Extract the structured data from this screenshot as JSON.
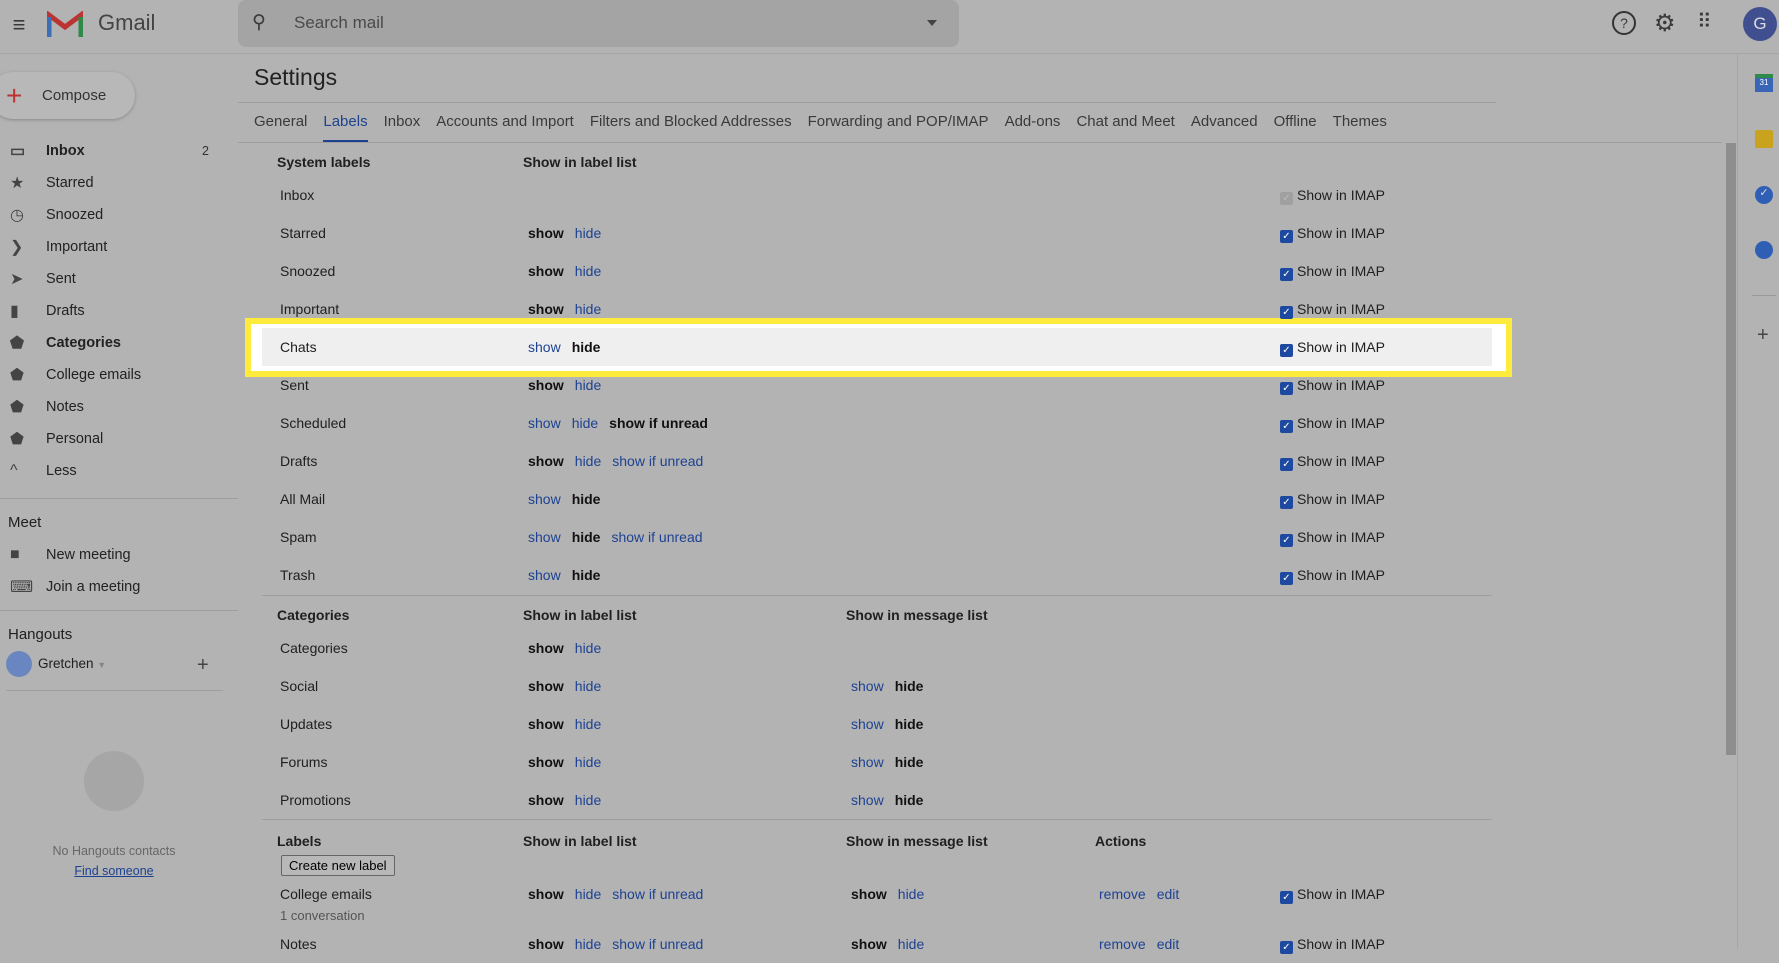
{
  "app": {
    "name": "Gmail",
    "avatar_letter": "G"
  },
  "search": {
    "placeholder": "Search mail"
  },
  "compose": "Compose",
  "sidebar": {
    "items": [
      {
        "label": "Inbox",
        "icon": "inbox-icon",
        "glyph": "▭",
        "bold": true,
        "count": "2"
      },
      {
        "label": "Starred",
        "icon": "star-icon",
        "glyph": "★"
      },
      {
        "label": "Snoozed",
        "icon": "clock-icon",
        "glyph": "◷"
      },
      {
        "label": "Important",
        "icon": "important-icon",
        "glyph": "❯"
      },
      {
        "label": "Sent",
        "icon": "send-icon",
        "glyph": "➤"
      },
      {
        "label": "Drafts",
        "icon": "draft-icon",
        "glyph": "▮"
      },
      {
        "label": "Categories",
        "icon": "label-icon",
        "glyph": "⬟",
        "bold": true
      },
      {
        "label": "College emails",
        "icon": "label-icon",
        "glyph": "⬟"
      },
      {
        "label": "Notes",
        "icon": "label-icon",
        "glyph": "⬟"
      },
      {
        "label": "Personal",
        "icon": "label-icon",
        "glyph": "⬟"
      },
      {
        "label": "Less",
        "icon": "chevron-up-icon",
        "glyph": "^"
      }
    ]
  },
  "meet": {
    "title": "Meet",
    "new_meeting": "New meeting",
    "join": "Join a meeting"
  },
  "hangouts": {
    "title": "Hangouts",
    "user": "Gretchen",
    "empty": "No Hangouts contacts",
    "find": "Find someone"
  },
  "settings": {
    "title": "Settings",
    "tabs": [
      "General",
      "Labels",
      "Inbox",
      "Accounts and Import",
      "Filters and Blocked Addresses",
      "Forwarding and POP/IMAP",
      "Add-ons",
      "Chat and Meet",
      "Advanced",
      "Offline",
      "Themes"
    ],
    "active_tab": "Labels"
  },
  "system": {
    "header": "System labels",
    "col_label_list": "Show in label list",
    "imap_label": "Show in IMAP",
    "rows": [
      {
        "name": "Inbox",
        "opts": [],
        "imap": "disabled"
      },
      {
        "name": "Starred",
        "opts": [
          [
            "show",
            1
          ],
          [
            "hide",
            0
          ]
        ],
        "imap": "checked"
      },
      {
        "name": "Snoozed",
        "opts": [
          [
            "show",
            1
          ],
          [
            "hide",
            0
          ]
        ],
        "imap": "checked"
      },
      {
        "name": "Important",
        "opts": [
          [
            "show",
            1
          ],
          [
            "hide",
            0
          ]
        ],
        "imap": "checked"
      },
      {
        "name": "Chats",
        "opts": [
          [
            "show",
            0
          ],
          [
            "hide",
            1
          ]
        ],
        "imap": "checked",
        "highlight": true
      },
      {
        "name": "Sent",
        "opts": [
          [
            "show",
            1
          ],
          [
            "hide",
            0
          ]
        ],
        "imap": "checked"
      },
      {
        "name": "Scheduled",
        "opts": [
          [
            "show",
            0
          ],
          [
            "hide",
            0
          ],
          [
            "show if unread",
            1
          ]
        ],
        "imap": "checked"
      },
      {
        "name": "Drafts",
        "opts": [
          [
            "show",
            1
          ],
          [
            "hide",
            0
          ],
          [
            "show if unread",
            0
          ]
        ],
        "imap": "checked"
      },
      {
        "name": "All Mail",
        "opts": [
          [
            "show",
            0
          ],
          [
            "hide",
            1
          ]
        ],
        "imap": "checked"
      },
      {
        "name": "Spam",
        "opts": [
          [
            "show",
            0
          ],
          [
            "hide",
            1
          ],
          [
            "show if unread",
            0
          ]
        ],
        "imap": "checked"
      },
      {
        "name": "Trash",
        "opts": [
          [
            "show",
            0
          ],
          [
            "hide",
            1
          ]
        ],
        "imap": "checked"
      }
    ]
  },
  "categories": {
    "header": "Categories",
    "col_label_list": "Show in label list",
    "col_msg_list": "Show in message list",
    "rows": [
      {
        "name": "Categories",
        "opts": [
          [
            "show",
            1
          ],
          [
            "hide",
            0
          ]
        ]
      },
      {
        "name": "Social",
        "opts": [
          [
            "show",
            1
          ],
          [
            "hide",
            0
          ]
        ],
        "msg": [
          [
            "show",
            0
          ],
          [
            "hide",
            1
          ]
        ]
      },
      {
        "name": "Updates",
        "opts": [
          [
            "show",
            1
          ],
          [
            "hide",
            0
          ]
        ],
        "msg": [
          [
            "show",
            0
          ],
          [
            "hide",
            1
          ]
        ]
      },
      {
        "name": "Forums",
        "opts": [
          [
            "show",
            1
          ],
          [
            "hide",
            0
          ]
        ],
        "msg": [
          [
            "show",
            0
          ],
          [
            "hide",
            1
          ]
        ]
      },
      {
        "name": "Promotions",
        "opts": [
          [
            "show",
            1
          ],
          [
            "hide",
            0
          ]
        ],
        "msg": [
          [
            "show",
            0
          ],
          [
            "hide",
            1
          ]
        ]
      }
    ]
  },
  "labels": {
    "header": "Labels",
    "col_label_list": "Show in label list",
    "col_msg_list": "Show in message list",
    "col_actions": "Actions",
    "create": "Create new label",
    "rows": [
      {
        "name": "College emails",
        "sub": "1 conversation",
        "opts": [
          [
            "show",
            1
          ],
          [
            "hide",
            0
          ],
          [
            "show if unread",
            0
          ]
        ],
        "msg": [
          [
            "show",
            1
          ],
          [
            "hide",
            0
          ]
        ],
        "actions": [
          "remove",
          "edit"
        ],
        "imap": "checked"
      },
      {
        "name": "Notes",
        "opts": [
          [
            "show",
            1
          ],
          [
            "hide",
            0
          ],
          [
            "show if unread",
            0
          ]
        ],
        "msg": [
          [
            "show",
            1
          ],
          [
            "hide",
            0
          ]
        ],
        "actions": [
          "remove",
          "edit"
        ],
        "imap": "checked"
      }
    ]
  },
  "colors": {
    "highlight_border": "#ffeb3b",
    "link": "#1d4292",
    "overlay_bg": "#b3b3b3"
  }
}
